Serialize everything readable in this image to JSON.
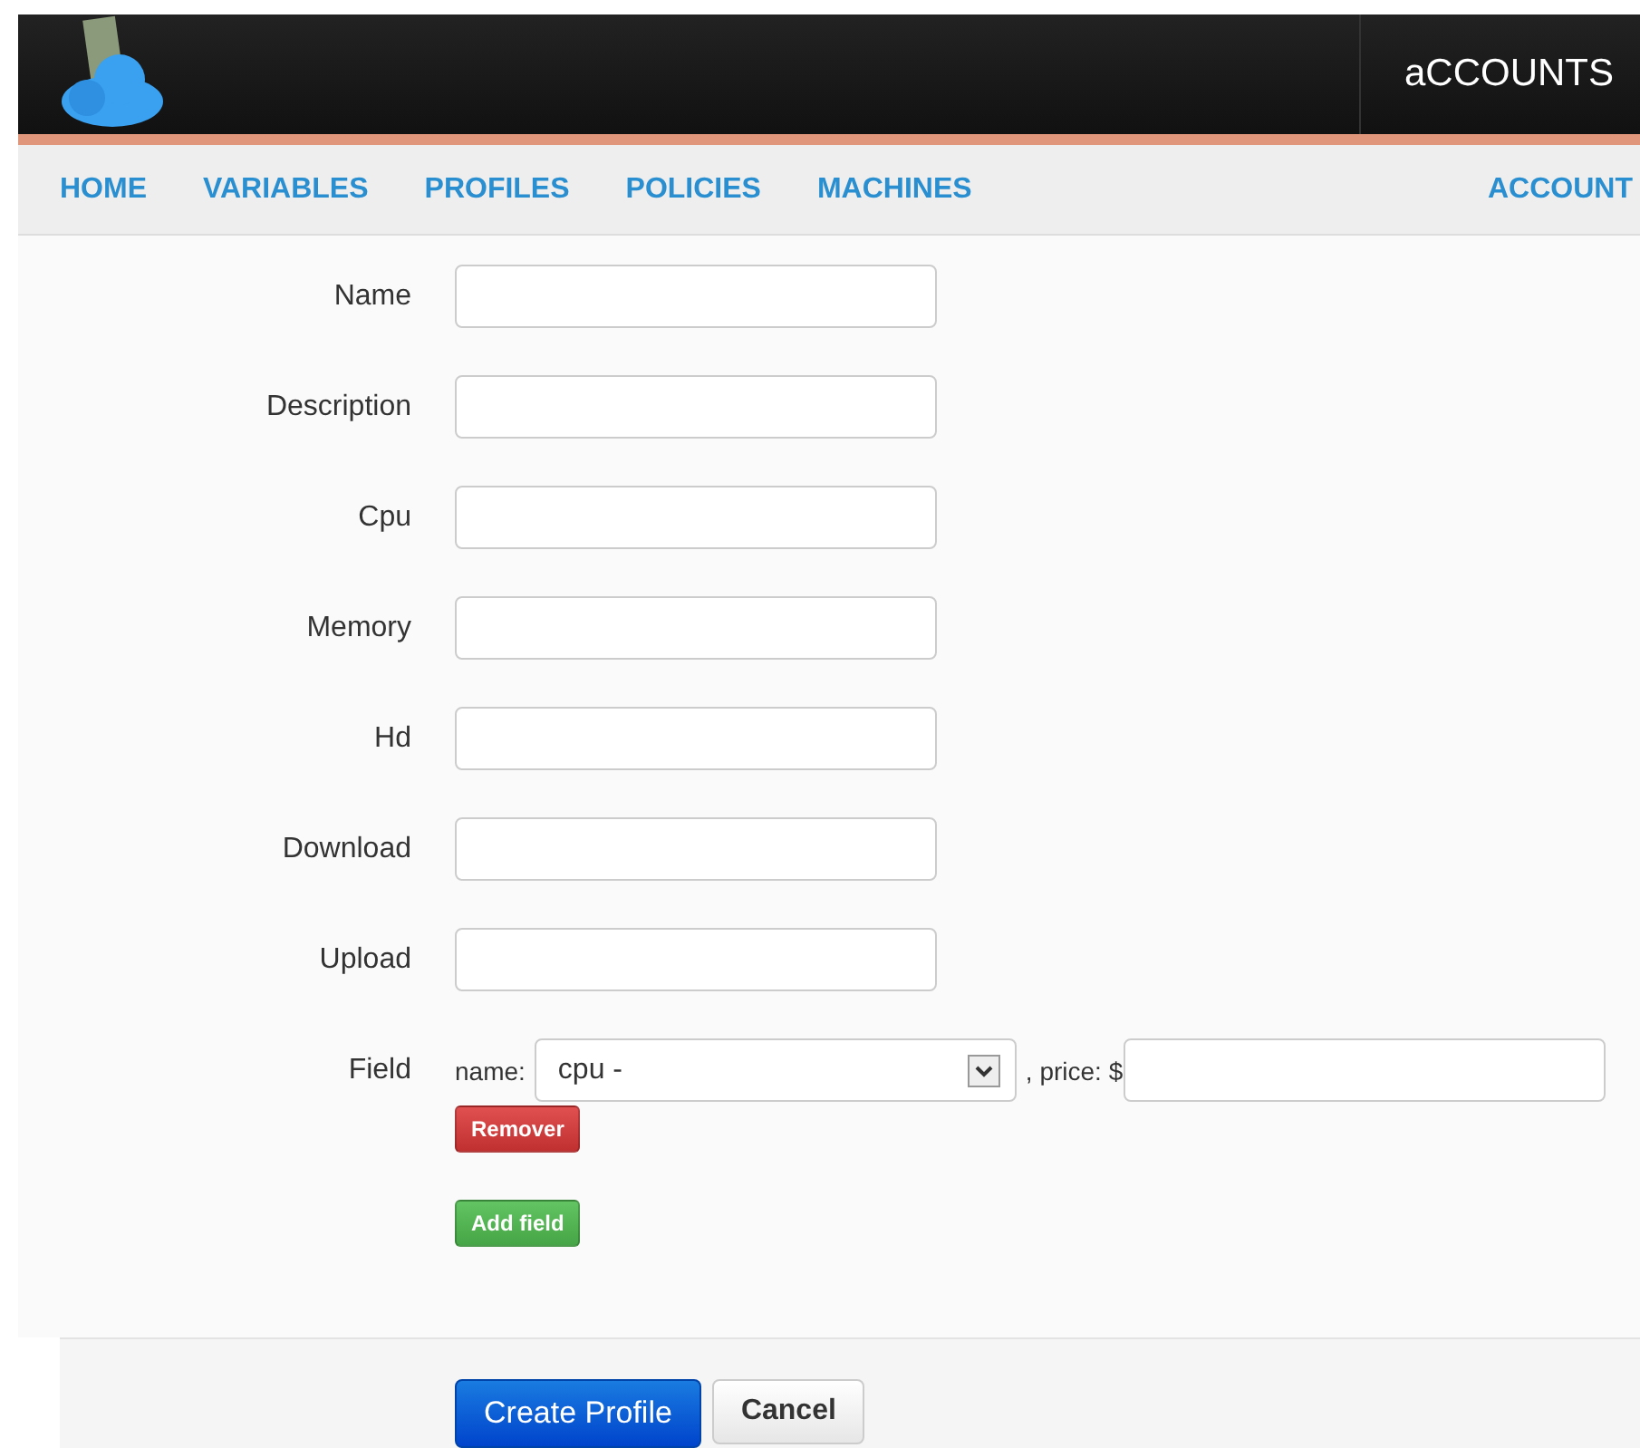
{
  "brand": {
    "title": "aCCOUNTS"
  },
  "nav": {
    "items": [
      {
        "label": "HOME"
      },
      {
        "label": "VARIABLES"
      },
      {
        "label": "PROFILES"
      },
      {
        "label": "POLICIES"
      },
      {
        "label": "MACHINES"
      }
    ],
    "account": {
      "label": "ACCOUNT"
    }
  },
  "form": {
    "fields": [
      {
        "label": "Name"
      },
      {
        "label": "Description"
      },
      {
        "label": "Cpu"
      },
      {
        "label": "Memory"
      },
      {
        "label": "Hd"
      },
      {
        "label": "Download"
      },
      {
        "label": "Upload"
      }
    ],
    "field_row": {
      "label": "Field",
      "name_label": "name:",
      "name_value": "cpu -",
      "price_label": ", price: $",
      "remove_button": "Remover"
    },
    "add_button": "Add field"
  },
  "actions": {
    "submit": "Create Profile",
    "cancel": "Cancel"
  }
}
